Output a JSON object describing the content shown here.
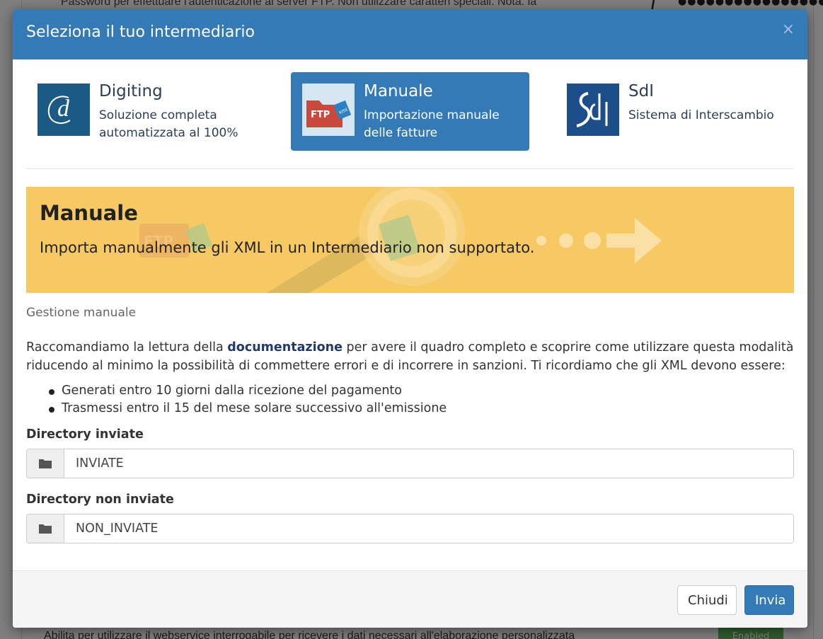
{
  "background": {
    "help_text": "Password per effettuare l'autenticazione al server FTP. Non utilizzare caratteri speciali. Nota: la",
    "password_mask": "●●●●●●●●●●●●●●●●●●",
    "bottom_text": "Abilita per utilizzare il webservice interrogabile per ricevere i dati necessari all'elaborazione personalizzata",
    "enabled_badge": "Enabled"
  },
  "modal": {
    "title": "Seleziona il tuo intermediario",
    "close_glyph": "×"
  },
  "providers": [
    {
      "name": "Digiting",
      "desc": "Soluzione completa automatizzata al 100%",
      "logo": "digiting-logo",
      "active": false
    },
    {
      "name": "Manuale",
      "desc": "Importazione manuale delle fatture",
      "logo": "ftp-xml-icon",
      "active": true
    },
    {
      "name": "SdI",
      "desc": "Sistema di Interscambio",
      "logo": "sdi-logo",
      "active": false
    }
  ],
  "logo_text": {
    "ftp": "FTP",
    "xml": "xml"
  },
  "banner": {
    "title": "Manuale",
    "subtitle": "Importa manualmente gli XML in un Intermediario non supportato.",
    "decor_ftp": "FTP"
  },
  "section_label": "Gestione manuale",
  "intro": {
    "before": "Raccomandiamo la lettura della ",
    "link": "documentazione",
    "after": " per avere il quadro completo e scoprire come utilizzare questa modalità riducendo al minimo la possibilità di commettere errori e di incorrere in sanzioni. Ti ricordiamo che gli XML devono essere:"
  },
  "bullets": [
    "Generati entro 10 giorni dalla ricezione del pagamento",
    "Trasmessi entro il 15 del mese solare successivo all'emissione"
  ],
  "fields": {
    "sent": {
      "label": "Directory inviate",
      "value": "INVIATE"
    },
    "not_sent": {
      "label": "Directory non inviate",
      "value": "NON_INVIATE"
    }
  },
  "footer": {
    "close_label": "Chiudi",
    "send_label": "Invia"
  },
  "colors": {
    "primary": "#337ab7",
    "banner": "#f6c964",
    "digiting": "#1c5a86",
    "sdi": "#1c4f8a"
  }
}
